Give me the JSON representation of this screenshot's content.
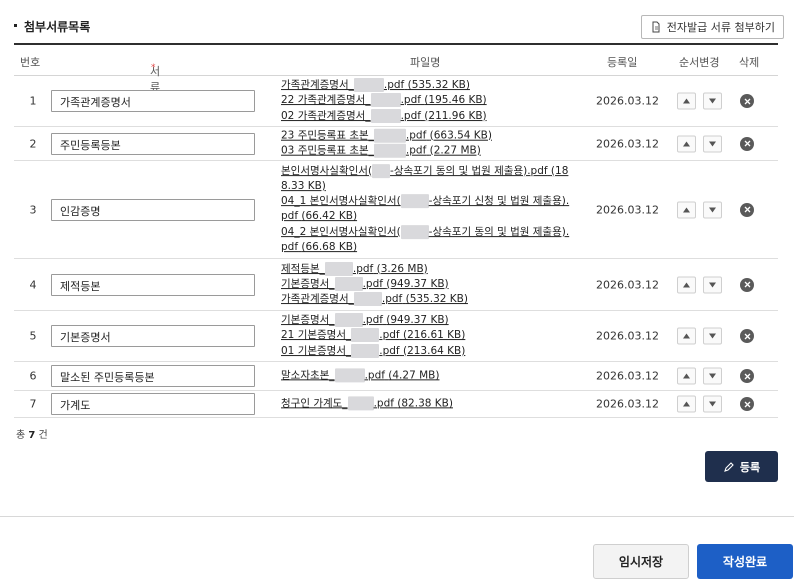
{
  "section": {
    "title": "첨부서류목록",
    "attach_button": "전자발급 서류 첨부하기"
  },
  "columns": {
    "num": "번호",
    "doc_name": "서류명",
    "doc_name_required": "*",
    "file_name": "파일명",
    "reg_date": "등록일",
    "order": "순서변경",
    "delete": "삭제"
  },
  "rows": [
    {
      "num": "1",
      "doc_name": "가족관계증명서",
      "date": "2026.03.12",
      "files": [
        {
          "pre": "가족관계증명서_",
          "post": ".pdf",
          "size": "(535.32 KB)"
        },
        {
          "pre": "22 가족관계증명서_",
          "post": ".pdf",
          "size": "(195.46 KB)"
        },
        {
          "pre": "02 가족관계증명서_",
          "post": ".pdf",
          "size": "(211.96 KB)"
        }
      ]
    },
    {
      "num": "2",
      "doc_name": "주민등록등본",
      "date": "2026.03.12",
      "files": [
        {
          "pre": "23 주민등록표 초본_",
          "post": ".pdf",
          "size": "(663.54 KB)"
        },
        {
          "pre": "03 주민등록표 초본_",
          "post": ".pdf",
          "size": "(2.27 MB)"
        }
      ]
    },
    {
      "num": "3",
      "doc_name": "인감증명",
      "date": "2026.03.12",
      "files": [
        {
          "pre": "본인서명사실확인서(",
          "post": "-상속포기 동의 및 법원 제출용).pdf",
          "size": "(18 8.33 KB)"
        },
        {
          "pre": "04_1 본인서명사실확인서(",
          "post": "-상속포기 신청 및 법원 제출용).pdf",
          "size": "(66.42 KB)"
        },
        {
          "pre": "04_2 본인서명사실확인서(",
          "post": "-상속포기 동의 및 법원 제출용).pdf",
          "size": "(66.68 KB)"
        }
      ]
    },
    {
      "num": "4",
      "doc_name": "제적등본",
      "date": "2026.03.12",
      "files": [
        {
          "pre": "제적등본_",
          "post": ".pdf",
          "size": "(3.26 MB)"
        },
        {
          "pre": "기본증명서_",
          "post": ".pdf",
          "size": "(949.37 KB)"
        },
        {
          "pre": "가족관계증명서_",
          "post": ".pdf",
          "size": "(535.32 KB)"
        }
      ]
    },
    {
      "num": "5",
      "doc_name": "기본증명서",
      "date": "2026.03.12",
      "files": [
        {
          "pre": "기본증명서_",
          "post": ".pdf",
          "size": "(949.37 KB)"
        },
        {
          "pre": "21 기본증명서_",
          "post": ".pdf",
          "size": "(216.61 KB)"
        },
        {
          "pre": "01 기본증명서_",
          "post": ".pdf",
          "size": "(213.64 KB)"
        }
      ]
    },
    {
      "num": "6",
      "doc_name": "말소된 주민등록등본",
      "date": "2026.03.12",
      "files": [
        {
          "pre": "말소자초본_",
          "post": ".pdf",
          "size": "(4.27 MB)"
        }
      ]
    },
    {
      "num": "7",
      "doc_name": "가계도",
      "date": "2026.03.12",
      "files": [
        {
          "pre": "청구인 가계도_",
          "post": ".pdf",
          "size": "(82.38 KB)"
        }
      ]
    }
  ],
  "total": {
    "prefix": "총",
    "count": "7",
    "suffix": "건"
  },
  "buttons": {
    "register": "등록",
    "temp_save": "임시저장",
    "complete": "작성완료"
  },
  "colors": {
    "register_bg": "#1f2f4d",
    "complete_bg": "#1d5fc6",
    "required_mark": "#e24b4b"
  }
}
